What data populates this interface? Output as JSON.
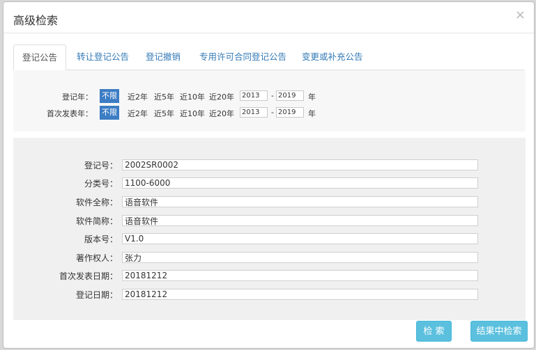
{
  "dialog": {
    "title": "高级检索",
    "close_symbol": "×"
  },
  "tabs": [
    {
      "label": "登记公告",
      "active": true
    },
    {
      "label": "转让登记公告"
    },
    {
      "label": "登记撤销"
    },
    {
      "label": "专用许可合同登记公告"
    },
    {
      "label": "变更或补充公告"
    }
  ],
  "year_filters": [
    {
      "label": "登记年：",
      "options": [
        "不限",
        "近2年",
        "近5年",
        "近10年",
        "近20年"
      ],
      "selected": "不限",
      "from": "2013",
      "to": "2019",
      "separator": "-",
      "unit": "年"
    },
    {
      "label": "首次发表年：",
      "options": [
        "不限",
        "近2年",
        "近5年",
        "近10年",
        "近20年"
      ],
      "selected": "不限",
      "from": "2013",
      "to": "2019",
      "separator": "-",
      "unit": "年"
    }
  ],
  "fields": [
    {
      "label": "登记号：",
      "value": "2002SR0002"
    },
    {
      "label": "分类号：",
      "value": "1100-6000"
    },
    {
      "label": "软件全称：",
      "value": "语音软件"
    },
    {
      "label": "软件简称：",
      "value": "语音软件"
    },
    {
      "label": "版本号：",
      "value": "V1.0"
    },
    {
      "label": "著作权人：",
      "value": "张力"
    },
    {
      "label": "首次发表日期：",
      "value": "20181212"
    },
    {
      "label": "登记日期：",
      "value": "20181212"
    }
  ],
  "buttons": {
    "search": "检 索",
    "search_in_results": "结果中检索"
  },
  "colors": {
    "selected_option": "#3c7dc4",
    "button": "#5bc0de",
    "tab_link": "#337ab7"
  }
}
